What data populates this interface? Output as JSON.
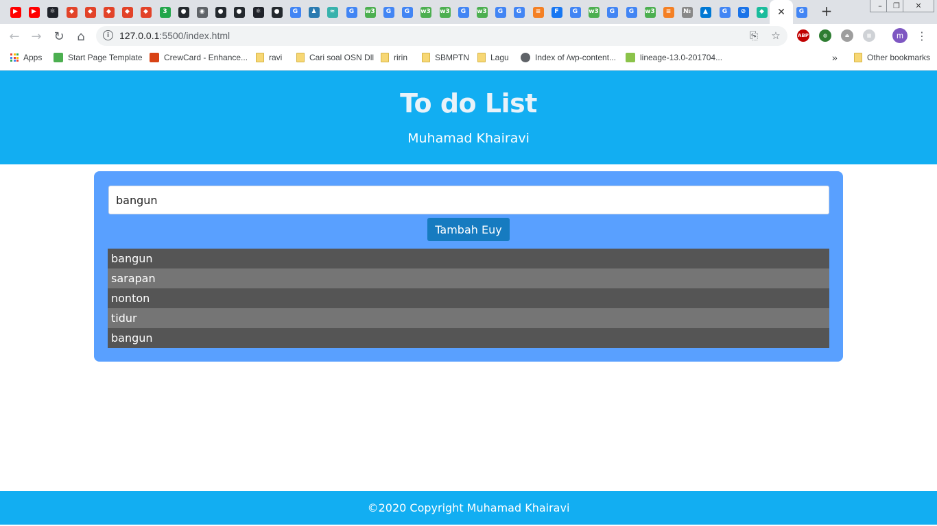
{
  "browser": {
    "url_host": "127.0.0.1",
    "url_path": ":5500/index.html",
    "profile_initial": "m",
    "window_buttons": [
      "–",
      "❐",
      "✕"
    ],
    "tab_close": "✕",
    "new_tab": "+",
    "tabs": [
      {
        "icon": "youtube-icon",
        "color": "#ff0000",
        "glyph": "▶"
      },
      {
        "icon": "youtube-icon",
        "color": "#ff0000",
        "glyph": "▶"
      },
      {
        "icon": "react-icon",
        "color": "#20232a",
        "glyph": "⚛"
      },
      {
        "icon": "gitlab-icon",
        "color": "#e24329",
        "glyph": "◆"
      },
      {
        "icon": "gitlab-icon",
        "color": "#e24329",
        "glyph": "◆"
      },
      {
        "icon": "gitlab-icon",
        "color": "#e24329",
        "glyph": "◆"
      },
      {
        "icon": "gitlab-icon",
        "color": "#e24329",
        "glyph": "◆"
      },
      {
        "icon": "gitlab-icon",
        "color": "#e24329",
        "glyph": "◆"
      },
      {
        "icon": "badge-3-icon",
        "color": "#22a64b",
        "glyph": "3"
      },
      {
        "icon": "github-icon",
        "color": "#24292e",
        "glyph": "●"
      },
      {
        "icon": "globe-icon",
        "color": "#5f6368",
        "glyph": "◉"
      },
      {
        "icon": "github-icon",
        "color": "#24292e",
        "glyph": "●"
      },
      {
        "icon": "github-icon",
        "color": "#24292e",
        "glyph": "●"
      },
      {
        "icon": "react-icon",
        "color": "#20232a",
        "glyph": "⚛"
      },
      {
        "icon": "github-icon",
        "color": "#24292e",
        "glyph": "●"
      },
      {
        "icon": "google-icon",
        "color": "#4285f4",
        "glyph": "G"
      },
      {
        "icon": "person-icon",
        "color": "#2a7ab0",
        "glyph": "♟"
      },
      {
        "icon": "tailwind-icon",
        "color": "#38b2ac",
        "glyph": "≈"
      },
      {
        "icon": "google-icon",
        "color": "#4285f4",
        "glyph": "G"
      },
      {
        "icon": "w3schools-icon",
        "color": "#4caf50",
        "glyph": "w3"
      },
      {
        "icon": "google-icon",
        "color": "#4285f4",
        "glyph": "G"
      },
      {
        "icon": "google-icon",
        "color": "#4285f4",
        "glyph": "G"
      },
      {
        "icon": "w3schools-icon",
        "color": "#4caf50",
        "glyph": "w3"
      },
      {
        "icon": "w3schools-icon",
        "color": "#4caf50",
        "glyph": "w3"
      },
      {
        "icon": "google-icon",
        "color": "#4285f4",
        "glyph": "G"
      },
      {
        "icon": "w3schools-icon",
        "color": "#4caf50",
        "glyph": "w3"
      },
      {
        "icon": "google-icon",
        "color": "#4285f4",
        "glyph": "G"
      },
      {
        "icon": "google-icon",
        "color": "#4285f4",
        "glyph": "G"
      },
      {
        "icon": "stackoverflow-icon",
        "color": "#f48024",
        "glyph": "≡"
      },
      {
        "icon": "facebook-icon",
        "color": "#1877f2",
        "glyph": "F"
      },
      {
        "icon": "google-icon",
        "color": "#4285f4",
        "glyph": "G"
      },
      {
        "icon": "w3schools-icon",
        "color": "#4caf50",
        "glyph": "w3"
      },
      {
        "icon": "google-icon",
        "color": "#4285f4",
        "glyph": "G"
      },
      {
        "icon": "google-icon",
        "color": "#4285f4",
        "glyph": "G"
      },
      {
        "icon": "w3schools-icon",
        "color": "#4caf50",
        "glyph": "w3"
      },
      {
        "icon": "stackoverflow-icon",
        "color": "#f48024",
        "glyph": "≡"
      },
      {
        "icon": "numero-icon",
        "color": "#888888",
        "glyph": "№"
      },
      {
        "icon": "azure-icon",
        "color": "#0078d4",
        "glyph": "▲"
      },
      {
        "icon": "google-icon",
        "color": "#4285f4",
        "glyph": "G"
      },
      {
        "icon": "slash-icon",
        "color": "#1a73e8",
        "glyph": "⊘"
      },
      {
        "icon": "diamond-icon",
        "color": "#1abc9c",
        "glyph": "◆"
      }
    ],
    "last_tab": {
      "icon": "google-icon",
      "color": "#4285f4",
      "glyph": "G"
    },
    "extensions": [
      {
        "icon": "adblock-icon",
        "color": "#c00000",
        "glyph": "ABP"
      },
      {
        "icon": "globe-extension-icon",
        "color": "#2e7d32",
        "glyph": "◍"
      },
      {
        "icon": "shoe-extension-icon",
        "color": "#9e9e9e",
        "glyph": "⏏"
      },
      {
        "icon": "puzzle-extension-icon",
        "color": "#cfd2d6",
        "glyph": "▦"
      }
    ],
    "bookmarks": [
      {
        "label": "Apps",
        "icon": "apps-grid-icon"
      },
      {
        "label": "Start Page Template",
        "icon": "w3schools-icon"
      },
      {
        "label": "CrewCard - Enhance...",
        "icon": "crewcard-icon"
      },
      {
        "label": "ravi",
        "icon": "folder-icon"
      },
      {
        "label": "Cari soal OSN Dll",
        "icon": "folder-icon"
      },
      {
        "label": "ririn",
        "icon": "folder-icon"
      },
      {
        "label": "SBMPTN",
        "icon": "folder-icon"
      },
      {
        "label": "Lagu",
        "icon": "folder-icon"
      },
      {
        "label": "Index of /wp-content...",
        "icon": "globe-icon"
      },
      {
        "label": "lineage-13.0-201704...",
        "icon": "image-icon"
      }
    ],
    "bookmarks_overflow": "»",
    "other_bookmarks": "Other bookmarks"
  },
  "header": {
    "title": "To do List",
    "subtitle": "Muhamad Khairavi"
  },
  "form": {
    "input_value": "bangun",
    "button_label": "Tambah Euy"
  },
  "todos": [
    "bangun",
    "sarapan",
    "nonton",
    "tidur",
    "bangun"
  ],
  "footer": {
    "copyright": "©2020 Copyright Muhamad Khairavi"
  },
  "colors": {
    "header_bg": "#12aef2",
    "card_bg": "#59a0ff",
    "button_bg": "#167bc0",
    "row_dark": "#555555",
    "row_light": "#757575"
  }
}
